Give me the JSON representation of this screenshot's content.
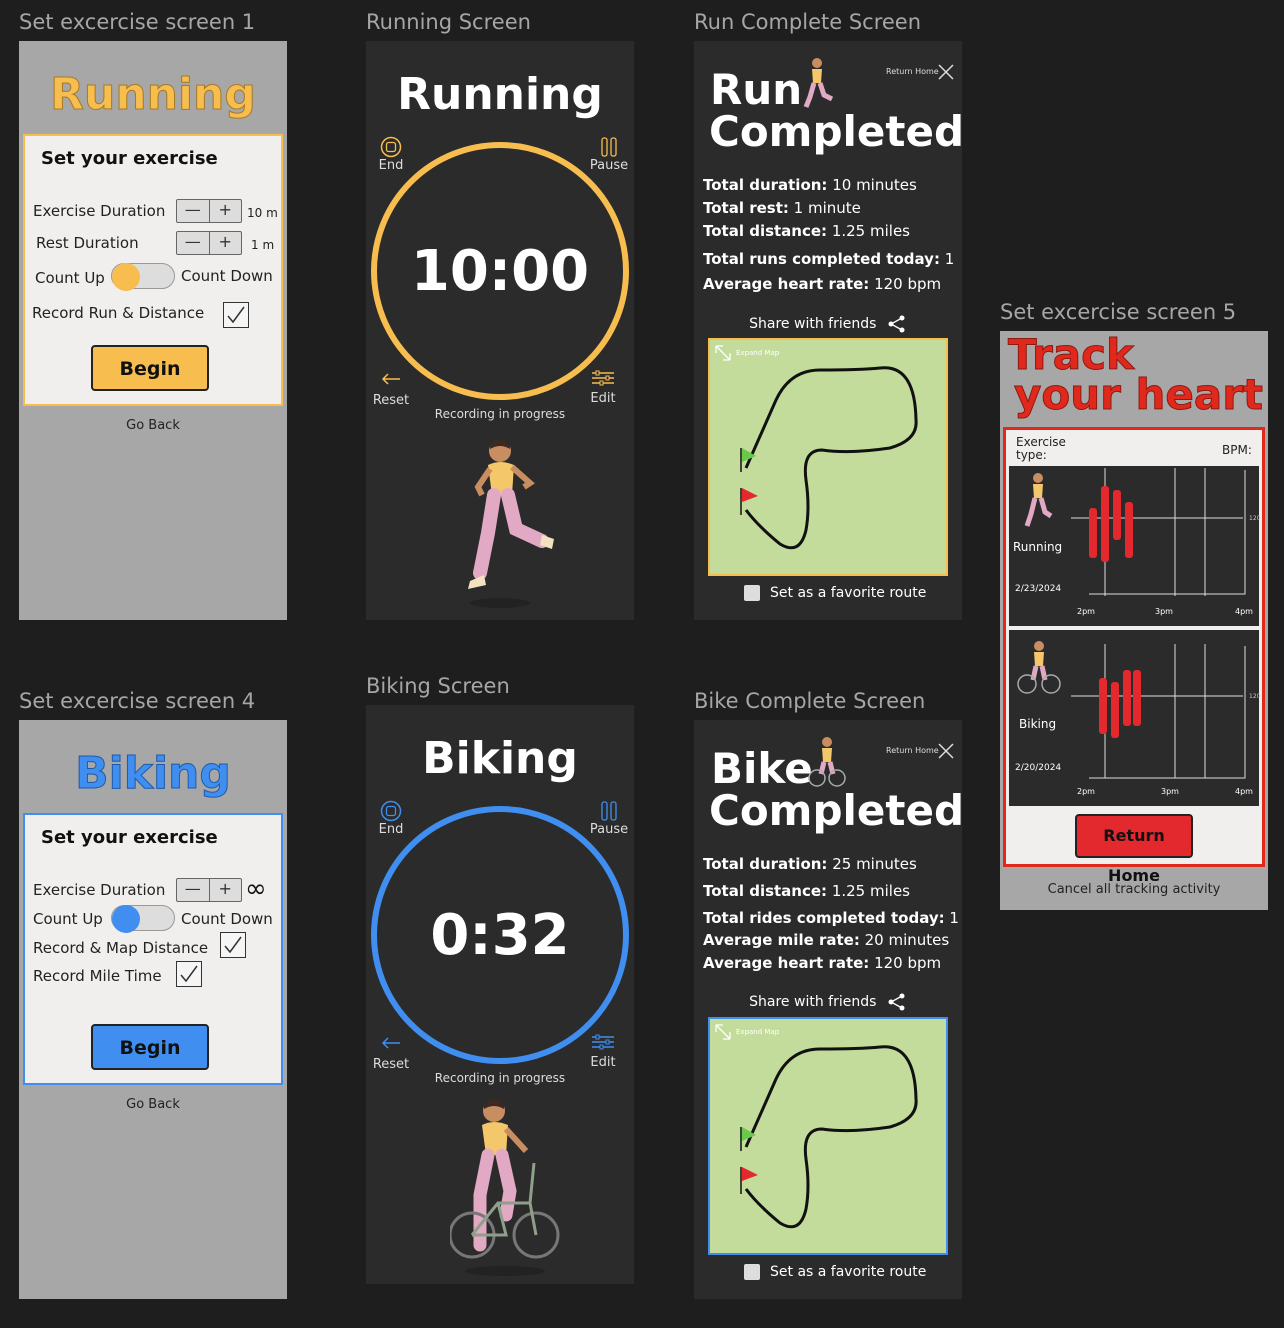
{
  "frames": {
    "set1": {
      "label": "Set excercise screen 1",
      "title": "Running",
      "card_title": "Set your exercise",
      "exercise_duration": "Exercise Duration",
      "exercise_unit": "10 m",
      "rest_duration": "Rest Duration",
      "rest_unit": "1 m",
      "count_up": "Count Up",
      "count_down": "Count Down",
      "record": "Record Run & Distance",
      "begin": "Begin",
      "go_back": "Go Back",
      "minus": "—",
      "plus": "+",
      "accent": "#f7bd4f"
    },
    "running": {
      "label": "Running Screen",
      "title": "Running",
      "end": "End",
      "pause": "Pause",
      "timer": "10:00",
      "reset": "Reset",
      "edit": "Edit",
      "recording": "Recording in progress"
    },
    "run_complete": {
      "label": "Run Complete Screen",
      "title_1": "Run",
      "title_2": "Completed",
      "return_home": "Return Home",
      "stats": [
        {
          "k": "Total duration:",
          "v": "10 minutes"
        },
        {
          "k": "Total rest:",
          "v": "1 minute"
        },
        {
          "k": "Total distance:",
          "v": "1.25 miles"
        },
        {
          "k": "Total runs completed today:",
          "v": "1"
        },
        {
          "k": "Average heart rate:",
          "v": "120 bpm"
        }
      ],
      "share": "Share with friends",
      "expand_map": "Expand Map",
      "favorite": "Set as a favorite route"
    },
    "set5": {
      "label": "Set excercise screen 5",
      "title_1": "Track",
      "title_2": "your heart",
      "exercise_type": "Exercise type:",
      "bpm": "BPM:",
      "row1": {
        "name": "Running",
        "date": "2/23/2024",
        "ticks": [
          "2pm",
          "3pm",
          "4pm"
        ],
        "ymark": "120"
      },
      "row2": {
        "name": "Biking",
        "date": "2/20/2024",
        "ticks": [
          "2pm",
          "3pm",
          "4pm"
        ],
        "ymark": "120"
      },
      "return_home": "Return Home",
      "cancel": "Cancel all tracking activity",
      "accent": "#e0281c"
    },
    "set4": {
      "label": "Set excercise screen 4",
      "title": "Biking",
      "card_title": "Set your exercise",
      "exercise_duration": "Exercise Duration",
      "infinity": "∞",
      "count_up": "Count Up",
      "count_down": "Count Down",
      "record_map": "Record & Map Distance",
      "record_mile": "Record Mile Time",
      "begin": "Begin",
      "go_back": "Go Back",
      "minus": "—",
      "plus": "+",
      "accent": "#3f8ef0"
    },
    "biking": {
      "label": "Biking Screen",
      "title": "Biking",
      "end": "End",
      "pause": "Pause",
      "timer": "0:32",
      "reset": "Reset",
      "edit": "Edit",
      "recording": "Recording in progress"
    },
    "bike_complete": {
      "label": "Bike Complete Screen",
      "title_1": "Bike",
      "title_2": "Completed",
      "return_home": "Return Home",
      "stats": [
        {
          "k": "Total duration:",
          "v": "25 minutes"
        },
        {
          "k": "Total distance:",
          "v": "1.25 miles"
        },
        {
          "k": "Total rides completed today:",
          "v": "1"
        },
        {
          "k": "Average mile rate:",
          "v": "20 minutes"
        },
        {
          "k": "Average heart rate:",
          "v": "120 bpm"
        }
      ],
      "share": "Share with friends",
      "expand_map": "Expand Map",
      "favorite": "Set as a favorite route"
    }
  }
}
